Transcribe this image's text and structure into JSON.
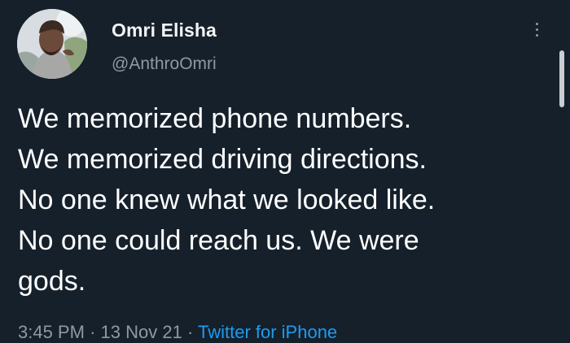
{
  "author": {
    "display_name": "Omri Elisha",
    "handle": "@AnthroOmri"
  },
  "tweet": {
    "lines": [
      "We memorized phone numbers.",
      "We memorized driving directions.",
      "No one knew what we looked like.",
      "No one could reach us. We were",
      "gods."
    ],
    "time": "3:45 PM",
    "separator": "·",
    "date": "13 Nov 21",
    "source": "Twitter for iPhone"
  },
  "icons": {
    "more": "more-vertical-icon",
    "avatar": "profile-photo"
  },
  "colors": {
    "background": "#15202b",
    "text": "#ffffff",
    "secondary_text": "#8d99a6",
    "link": "#1d9bf0"
  }
}
